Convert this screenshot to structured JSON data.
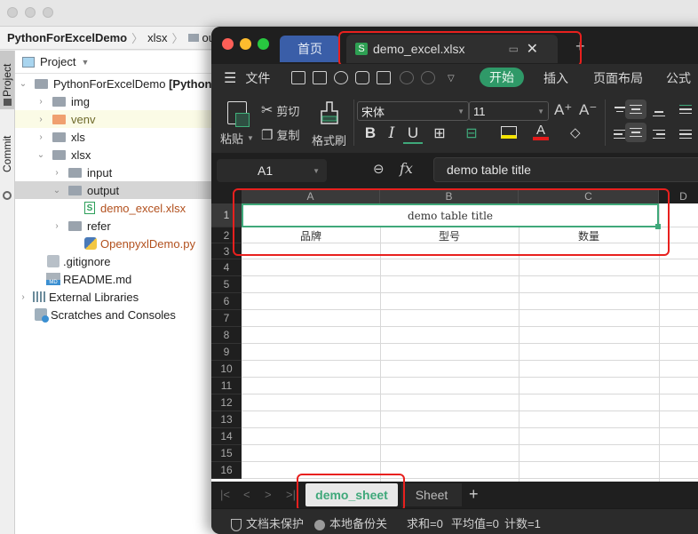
{
  "ide": {
    "breadcrumb": [
      "PythonForExcelDemo",
      "xlsx",
      "output"
    ],
    "tool_strip": {
      "project": "Project",
      "commit": "Commit"
    },
    "project_panel": {
      "title": "Project",
      "tree": [
        {
          "label": "PythonForExcelDemo",
          "suffix": "[Python",
          "type": "folder",
          "expanded": true
        },
        {
          "label": "img",
          "type": "folder"
        },
        {
          "label": "venv",
          "type": "folder-excluded"
        },
        {
          "label": "xls",
          "type": "folder"
        },
        {
          "label": "xlsx",
          "type": "folder",
          "expanded": true
        },
        {
          "label": "input",
          "type": "folder"
        },
        {
          "label": "output",
          "type": "folder",
          "expanded": true,
          "selected": true
        },
        {
          "label": "demo_excel.xlsx",
          "type": "xlsx-file"
        },
        {
          "label": "refer",
          "type": "folder"
        },
        {
          "label": "OpenpyxlDemo.py",
          "type": "python-file"
        },
        {
          "label": ".gitignore",
          "type": "ignore-file"
        },
        {
          "label": "README.md",
          "type": "markdown-file"
        },
        {
          "label": "External Libraries",
          "type": "libraries"
        },
        {
          "label": "Scratches and Consoles",
          "type": "scratches"
        }
      ]
    }
  },
  "wps": {
    "tabs": {
      "home": "首页",
      "document": "demo_excel.xlsx"
    },
    "menu": {
      "file": "文件",
      "start": "开始",
      "insert": "插入",
      "page_layout": "页面布局",
      "formula": "公式"
    },
    "ribbon": {
      "paste": "粘贴",
      "cut": "剪切",
      "copy": "复制",
      "format_painter": "格式刷",
      "font_name": "宋体",
      "font_size": "11",
      "bold": "B",
      "italic": "I",
      "underline": "U",
      "font_increase": "A⁺",
      "font_decrease": "A⁻",
      "highlight_color": "#f5e400",
      "font_color": "#e31b1b"
    },
    "formula_bar": {
      "cell_ref": "A1",
      "fx": "fx",
      "value": "demo table title"
    },
    "grid": {
      "columns": [
        "A",
        "B",
        "C",
        "D"
      ],
      "rows": [
        "1",
        "2",
        "3",
        "4",
        "5",
        "6",
        "7",
        "8",
        "9",
        "10",
        "11",
        "12",
        "13",
        "14",
        "15",
        "16"
      ],
      "cells": {
        "A1": "demo table title",
        "A2": "品牌",
        "B2": "型号",
        "C2": "数量"
      },
      "selection": "A1:C1",
      "selection_color": "#3fa87a"
    },
    "sheets": [
      {
        "name": "demo_sheet",
        "active": true
      },
      {
        "name": "Sheet",
        "active": false
      }
    ],
    "status": {
      "protection": "文档未保护",
      "backup": "本地备份关",
      "sum": "求和=0",
      "average": "平均值=0",
      "count": "计数=1"
    },
    "accent": "#2f9968",
    "annotation_color": "#e8201e"
  }
}
